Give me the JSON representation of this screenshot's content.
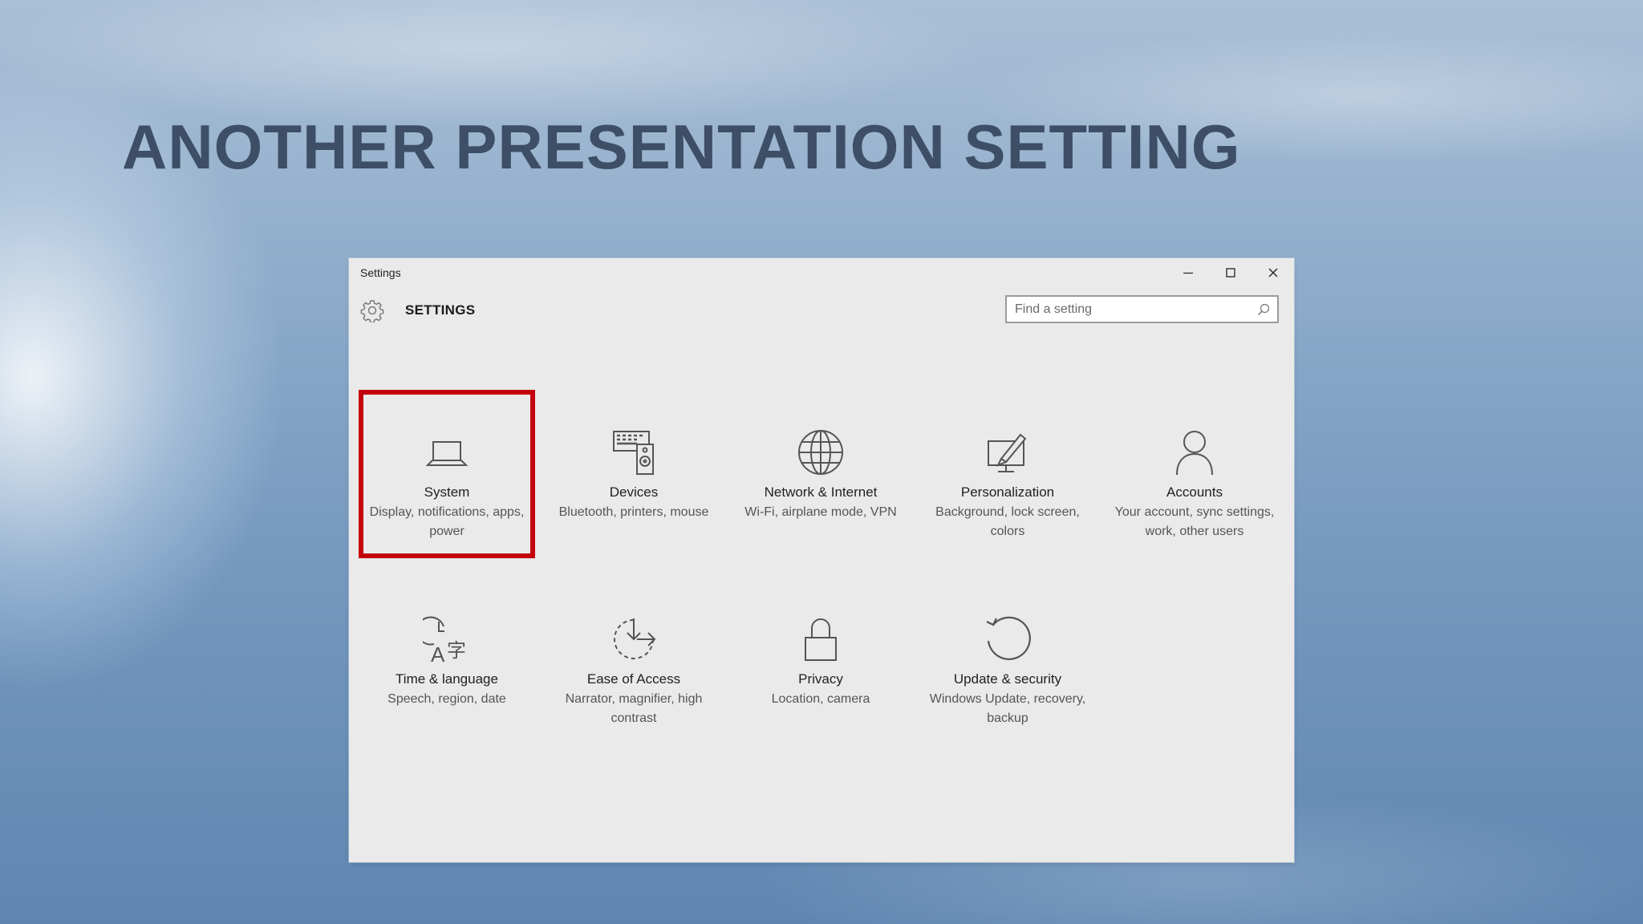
{
  "slide": {
    "title": "ANOTHER PRESENTATION SETTING"
  },
  "window": {
    "title": "Settings",
    "controls": {
      "minimize": "minimize-icon",
      "maximize": "maximize-icon",
      "close": "close-icon"
    }
  },
  "header": {
    "icon": "gear-icon",
    "title": "SETTINGS",
    "search_placeholder": "Find a setting",
    "search_value": ""
  },
  "categories": [
    {
      "name": "System",
      "description": "Display, notifications, apps, power",
      "icon": "laptop-icon",
      "highlighted": true
    },
    {
      "name": "Devices",
      "description": "Bluetooth, printers, mouse",
      "icon": "devices-icon",
      "highlighted": false
    },
    {
      "name": "Network & Internet",
      "description": "Wi-Fi, airplane mode, VPN",
      "icon": "globe-icon",
      "highlighted": false
    },
    {
      "name": "Personalization",
      "description": "Background, lock screen, colors",
      "icon": "personalization-icon",
      "highlighted": false
    },
    {
      "name": "Accounts",
      "description": "Your account, sync settings, work, other users",
      "icon": "person-icon",
      "highlighted": false
    },
    {
      "name": "Time & language",
      "description": "Speech, region, date",
      "icon": "time-language-icon",
      "highlighted": false
    },
    {
      "name": "Ease of Access",
      "description": "Narrator, magnifier, high contrast",
      "icon": "ease-of-access-icon",
      "highlighted": false
    },
    {
      "name": "Privacy",
      "description": "Location, camera",
      "icon": "lock-icon",
      "highlighted": false
    },
    {
      "name": "Update & security",
      "description": "Windows Update, recovery, backup",
      "icon": "update-icon",
      "highlighted": false
    }
  ],
  "colors": {
    "title_text": "#3d4e66",
    "window_bg": "#eaeaea",
    "highlight_border": "#c4000c",
    "icon_stroke": "#555555"
  }
}
